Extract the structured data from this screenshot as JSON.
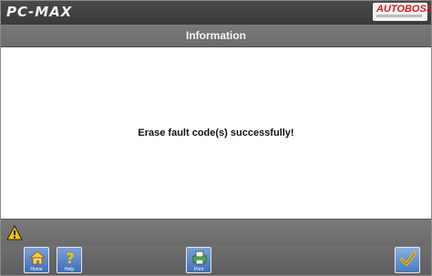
{
  "app": {
    "title": "PC-MAX",
    "logo": "AUTOBOSS"
  },
  "header": {
    "title": "Information"
  },
  "main": {
    "message": "Erase fault code(s) successfully!"
  },
  "status": {
    "icon": "warning-icon",
    "icon_color": "#f2c200"
  },
  "toolbar": {
    "home_label": "Home",
    "help_label": "Help",
    "print_label": "Print",
    "ok_icon": "checkmark-icon"
  },
  "colors": {
    "accent": "#4a78c0",
    "brand_red": "#d21f1f"
  }
}
